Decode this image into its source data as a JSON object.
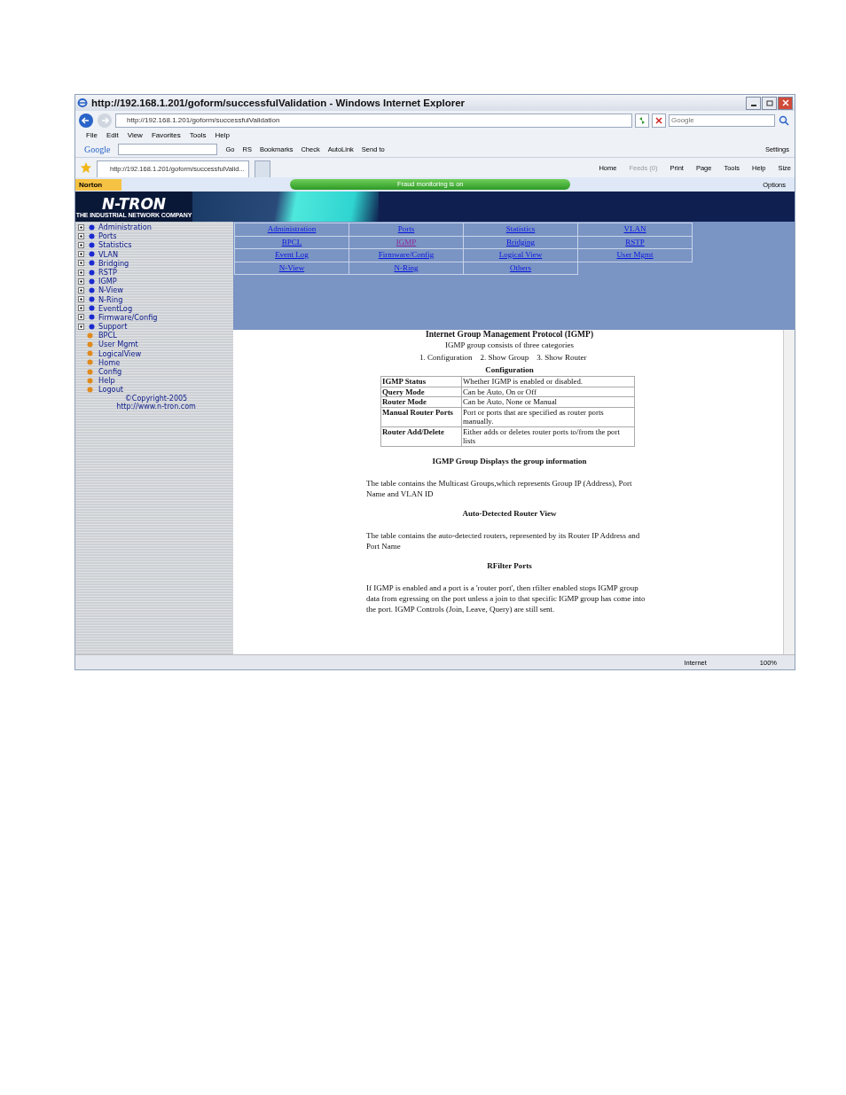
{
  "window": {
    "title": "http://192.168.1.201/goform/successfulValidation - Windows Internet Explorer"
  },
  "address_bar": {
    "url": "http://192.168.1.201/goform/successfulValidation"
  },
  "search": {
    "placeholder": "Google"
  },
  "menu": [
    "File",
    "Edit",
    "View",
    "Favorites",
    "Tools",
    "Help"
  ],
  "google_toolbar": {
    "logo": "Google",
    "items": [
      "Go",
      "RS",
      "Bookmarks",
      "Check",
      "AutoLink",
      "Send to"
    ],
    "settings": "Settings"
  },
  "tabs": [
    {
      "label": "http://192.168.1.201/goform/successfulValid...",
      "selected": true
    }
  ],
  "command_bar": [
    "Home",
    "Feeds (0)",
    "Print",
    "Page",
    "Tools",
    "Help",
    "Size"
  ],
  "norton_bar": {
    "brand": "Norton",
    "status": "Fraud monitoring is on",
    "options": "Options"
  },
  "banner": {
    "logo": "N-TRON",
    "tagline": "THE INDUSTRIAL NETWORK COMPANY"
  },
  "sidebar": {
    "items": [
      {
        "label": "Administration",
        "kind": "folder"
      },
      {
        "label": "Ports",
        "kind": "folder"
      },
      {
        "label": "Statistics",
        "kind": "folder"
      },
      {
        "label": "VLAN",
        "kind": "folder"
      },
      {
        "label": "Bridging",
        "kind": "folder"
      },
      {
        "label": "RSTP",
        "kind": "folder"
      },
      {
        "label": "IGMP",
        "kind": "folder"
      },
      {
        "label": "N-View",
        "kind": "folder"
      },
      {
        "label": "N-Ring",
        "kind": "folder"
      },
      {
        "label": "EventLog",
        "kind": "folder"
      },
      {
        "label": "Firmware/Config",
        "kind": "folder"
      },
      {
        "label": "Support",
        "kind": "folder"
      },
      {
        "label": "BPCL",
        "kind": "page"
      },
      {
        "label": "User Mgmt",
        "kind": "page"
      },
      {
        "label": "LogicalView",
        "kind": "page"
      },
      {
        "label": "Home",
        "kind": "page"
      },
      {
        "label": "Config",
        "kind": "page"
      },
      {
        "label": "Help",
        "kind": "page"
      },
      {
        "label": "Logout",
        "kind": "page"
      }
    ],
    "copyright": "©Copyright-2005",
    "link": "http://www.n-tron.com"
  },
  "nav_links": [
    {
      "label": "Administration",
      "selected": false
    },
    {
      "label": "Ports",
      "selected": false
    },
    {
      "label": "Statistics",
      "selected": false
    },
    {
      "label": "VLAN",
      "selected": false
    },
    {
      "label": "BPCL",
      "selected": false
    },
    {
      "label": "IGMP",
      "selected": true
    },
    {
      "label": "Bridging",
      "selected": false
    },
    {
      "label": "RSTP",
      "selected": false
    },
    {
      "label": "Event Log",
      "selected": false
    },
    {
      "label": "Firmware/Config",
      "selected": false
    },
    {
      "label": "Logical View",
      "selected": false
    },
    {
      "label": "User Mgmt",
      "selected": false
    },
    {
      "label": "N-View",
      "selected": false
    },
    {
      "label": "N-Ring",
      "selected": false
    },
    {
      "label": "Others",
      "selected": false
    }
  ],
  "content": {
    "heading": "Internet Group Management Protocol (IGMP)",
    "intro": "IGMP group consists of three categories",
    "categories": [
      "1. Configuration",
      "2. Show Group",
      "3. Show Router"
    ],
    "config_title": "Configuration",
    "config_table": [
      {
        "term": "IGMP Status",
        "description": "Whether IGMP is enabled or disabled."
      },
      {
        "term": "Query Mode",
        "description": "Can be Auto, On or Off"
      },
      {
        "term": "Router Mode",
        "description": "Can be Auto, None or Manual"
      },
      {
        "term": "Manual Router Ports",
        "description": "Port or ports that are specified as router ports manually."
      },
      {
        "term": "Router Add/Delete",
        "description": "Either adds or deletes router ports to/from the port lists"
      }
    ],
    "sections": [
      {
        "title": "IGMP Group Displays the group information",
        "body": "The table contains the Multicast Groups,which represents Group IP (Address), Port Name and VLAN ID"
      },
      {
        "title": "Auto-Detected Router View",
        "body": "The table contains the auto-detected routers, represented by its Router IP Address and Port Name"
      },
      {
        "title": "RFilter Ports",
        "body": "If IGMP is enabled and a port is a 'router port', then rfilter enabled stops IGMP group data from egressing on the port unless a join to that specific IGMP group has come into the port. IGMP Controls (Join, Leave, Query) are still sent."
      }
    ]
  },
  "status_bar": {
    "zone": "Internet",
    "zoom": "100%"
  }
}
